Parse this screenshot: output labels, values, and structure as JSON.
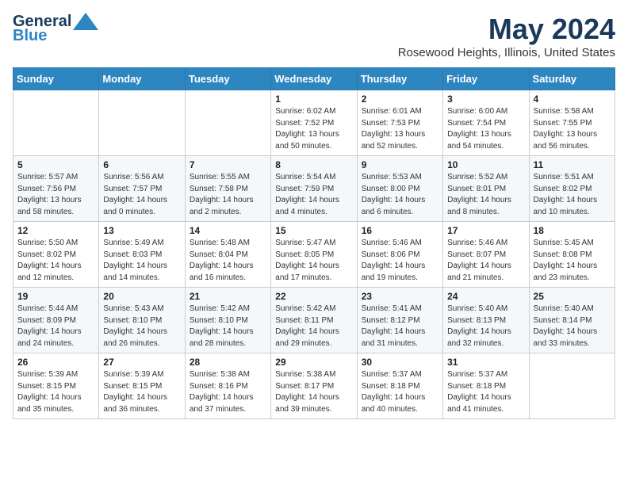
{
  "logo": {
    "line1": "General",
    "line2": "Blue"
  },
  "title": "May 2024",
  "subtitle": "Rosewood Heights, Illinois, United States",
  "days_of_week": [
    "Sunday",
    "Monday",
    "Tuesday",
    "Wednesday",
    "Thursday",
    "Friday",
    "Saturday"
  ],
  "weeks": [
    [
      {
        "day": "",
        "sunrise": "",
        "sunset": "",
        "daylight": ""
      },
      {
        "day": "",
        "sunrise": "",
        "sunset": "",
        "daylight": ""
      },
      {
        "day": "",
        "sunrise": "",
        "sunset": "",
        "daylight": ""
      },
      {
        "day": "1",
        "sunrise": "Sunrise: 6:02 AM",
        "sunset": "Sunset: 7:52 PM",
        "daylight": "Daylight: 13 hours and 50 minutes."
      },
      {
        "day": "2",
        "sunrise": "Sunrise: 6:01 AM",
        "sunset": "Sunset: 7:53 PM",
        "daylight": "Daylight: 13 hours and 52 minutes."
      },
      {
        "day": "3",
        "sunrise": "Sunrise: 6:00 AM",
        "sunset": "Sunset: 7:54 PM",
        "daylight": "Daylight: 13 hours and 54 minutes."
      },
      {
        "day": "4",
        "sunrise": "Sunrise: 5:58 AM",
        "sunset": "Sunset: 7:55 PM",
        "daylight": "Daylight: 13 hours and 56 minutes."
      }
    ],
    [
      {
        "day": "5",
        "sunrise": "Sunrise: 5:57 AM",
        "sunset": "Sunset: 7:56 PM",
        "daylight": "Daylight: 13 hours and 58 minutes."
      },
      {
        "day": "6",
        "sunrise": "Sunrise: 5:56 AM",
        "sunset": "Sunset: 7:57 PM",
        "daylight": "Daylight: 14 hours and 0 minutes."
      },
      {
        "day": "7",
        "sunrise": "Sunrise: 5:55 AM",
        "sunset": "Sunset: 7:58 PM",
        "daylight": "Daylight: 14 hours and 2 minutes."
      },
      {
        "day": "8",
        "sunrise": "Sunrise: 5:54 AM",
        "sunset": "Sunset: 7:59 PM",
        "daylight": "Daylight: 14 hours and 4 minutes."
      },
      {
        "day": "9",
        "sunrise": "Sunrise: 5:53 AM",
        "sunset": "Sunset: 8:00 PM",
        "daylight": "Daylight: 14 hours and 6 minutes."
      },
      {
        "day": "10",
        "sunrise": "Sunrise: 5:52 AM",
        "sunset": "Sunset: 8:01 PM",
        "daylight": "Daylight: 14 hours and 8 minutes."
      },
      {
        "day": "11",
        "sunrise": "Sunrise: 5:51 AM",
        "sunset": "Sunset: 8:02 PM",
        "daylight": "Daylight: 14 hours and 10 minutes."
      }
    ],
    [
      {
        "day": "12",
        "sunrise": "Sunrise: 5:50 AM",
        "sunset": "Sunset: 8:02 PM",
        "daylight": "Daylight: 14 hours and 12 minutes."
      },
      {
        "day": "13",
        "sunrise": "Sunrise: 5:49 AM",
        "sunset": "Sunset: 8:03 PM",
        "daylight": "Daylight: 14 hours and 14 minutes."
      },
      {
        "day": "14",
        "sunrise": "Sunrise: 5:48 AM",
        "sunset": "Sunset: 8:04 PM",
        "daylight": "Daylight: 14 hours and 16 minutes."
      },
      {
        "day": "15",
        "sunrise": "Sunrise: 5:47 AM",
        "sunset": "Sunset: 8:05 PM",
        "daylight": "Daylight: 14 hours and 17 minutes."
      },
      {
        "day": "16",
        "sunrise": "Sunrise: 5:46 AM",
        "sunset": "Sunset: 8:06 PM",
        "daylight": "Daylight: 14 hours and 19 minutes."
      },
      {
        "day": "17",
        "sunrise": "Sunrise: 5:46 AM",
        "sunset": "Sunset: 8:07 PM",
        "daylight": "Daylight: 14 hours and 21 minutes."
      },
      {
        "day": "18",
        "sunrise": "Sunrise: 5:45 AM",
        "sunset": "Sunset: 8:08 PM",
        "daylight": "Daylight: 14 hours and 23 minutes."
      }
    ],
    [
      {
        "day": "19",
        "sunrise": "Sunrise: 5:44 AM",
        "sunset": "Sunset: 8:09 PM",
        "daylight": "Daylight: 14 hours and 24 minutes."
      },
      {
        "day": "20",
        "sunrise": "Sunrise: 5:43 AM",
        "sunset": "Sunset: 8:10 PM",
        "daylight": "Daylight: 14 hours and 26 minutes."
      },
      {
        "day": "21",
        "sunrise": "Sunrise: 5:42 AM",
        "sunset": "Sunset: 8:10 PM",
        "daylight": "Daylight: 14 hours and 28 minutes."
      },
      {
        "day": "22",
        "sunrise": "Sunrise: 5:42 AM",
        "sunset": "Sunset: 8:11 PM",
        "daylight": "Daylight: 14 hours and 29 minutes."
      },
      {
        "day": "23",
        "sunrise": "Sunrise: 5:41 AM",
        "sunset": "Sunset: 8:12 PM",
        "daylight": "Daylight: 14 hours and 31 minutes."
      },
      {
        "day": "24",
        "sunrise": "Sunrise: 5:40 AM",
        "sunset": "Sunset: 8:13 PM",
        "daylight": "Daylight: 14 hours and 32 minutes."
      },
      {
        "day": "25",
        "sunrise": "Sunrise: 5:40 AM",
        "sunset": "Sunset: 8:14 PM",
        "daylight": "Daylight: 14 hours and 33 minutes."
      }
    ],
    [
      {
        "day": "26",
        "sunrise": "Sunrise: 5:39 AM",
        "sunset": "Sunset: 8:15 PM",
        "daylight": "Daylight: 14 hours and 35 minutes."
      },
      {
        "day": "27",
        "sunrise": "Sunrise: 5:39 AM",
        "sunset": "Sunset: 8:15 PM",
        "daylight": "Daylight: 14 hours and 36 minutes."
      },
      {
        "day": "28",
        "sunrise": "Sunrise: 5:38 AM",
        "sunset": "Sunset: 8:16 PM",
        "daylight": "Daylight: 14 hours and 37 minutes."
      },
      {
        "day": "29",
        "sunrise": "Sunrise: 5:38 AM",
        "sunset": "Sunset: 8:17 PM",
        "daylight": "Daylight: 14 hours and 39 minutes."
      },
      {
        "day": "30",
        "sunrise": "Sunrise: 5:37 AM",
        "sunset": "Sunset: 8:18 PM",
        "daylight": "Daylight: 14 hours and 40 minutes."
      },
      {
        "day": "31",
        "sunrise": "Sunrise: 5:37 AM",
        "sunset": "Sunset: 8:18 PM",
        "daylight": "Daylight: 14 hours and 41 minutes."
      },
      {
        "day": "",
        "sunrise": "",
        "sunset": "",
        "daylight": ""
      }
    ]
  ]
}
